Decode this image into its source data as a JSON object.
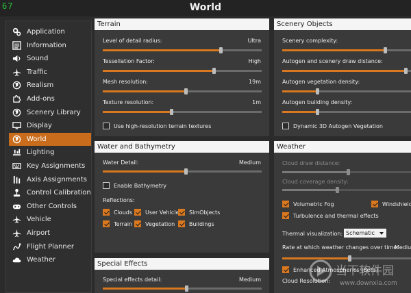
{
  "fps": "67",
  "window_title": "World",
  "sidebar": {
    "items": [
      {
        "label": "Application",
        "icon": "gears-icon"
      },
      {
        "label": "Information",
        "icon": "list-icon"
      },
      {
        "label": "Sound",
        "icon": "speaker-icon"
      },
      {
        "label": "Traffic",
        "icon": "plane-icon"
      },
      {
        "label": "Realism",
        "icon": "globe-icon"
      },
      {
        "label": "Add-ons",
        "icon": "puzzle-icon"
      },
      {
        "label": "Scenery Library",
        "icon": "globe-icon"
      },
      {
        "label": "Display",
        "icon": "monitor-icon"
      },
      {
        "label": "World",
        "icon": "globe-icon",
        "active": true
      },
      {
        "label": "Lighting",
        "icon": "lighting-icon"
      },
      {
        "label": "Key Assignments",
        "icon": "keyboard-icon"
      },
      {
        "label": "Axis Assignments",
        "icon": "axis-icon"
      },
      {
        "label": "Control Calibration",
        "icon": "joystick-icon"
      },
      {
        "label": "Other Controls",
        "icon": "gamepad-icon"
      },
      {
        "label": "Vehicle",
        "icon": "plane-icon"
      },
      {
        "label": "Airport",
        "icon": "plane-icon"
      },
      {
        "label": "Flight Planner",
        "icon": "route-icon"
      },
      {
        "label": "Weather",
        "icon": "cloud-icon"
      }
    ]
  },
  "terrain": {
    "title": "Terrain",
    "sliders": [
      {
        "label": "Level of detail radius:",
        "value": "Ultra",
        "level": 0.74
      },
      {
        "label": "Tessellation Factor:",
        "value": "High",
        "level": 0.7
      },
      {
        "label": "Mesh resolution:",
        "value": "19m",
        "level": 0.52
      },
      {
        "label": "Texture resolution:",
        "value": "1m",
        "level": 0.43
      }
    ],
    "checkbox": {
      "label": "Use high-resolution terrain textures",
      "checked": false
    }
  },
  "scenery": {
    "title": "Scenery Objects",
    "sliders": [
      {
        "label": "Scenery complexity:",
        "level": 0.8
      },
      {
        "label": "Autogen and scenery draw distance:",
        "level": 0.96
      },
      {
        "label": "Autogen vegetation density:",
        "level": 0.27
      },
      {
        "label": "Autogen building density:",
        "level": 0.27
      }
    ],
    "checkbox": {
      "label": "Dynamic 3D Autogen Vegetation",
      "checked": false
    }
  },
  "water": {
    "title": "Water and Bathymetry",
    "slider": {
      "label": "Water Detail:",
      "value": "Medium",
      "level": 0.52
    },
    "enable": {
      "label": "Enable Bathymetry",
      "checked": false
    },
    "reflections_label": "Reflections:",
    "reflections": [
      {
        "label": "Clouds",
        "checked": true
      },
      {
        "label": "User Vehicle",
        "checked": true
      },
      {
        "label": "SimObjects",
        "checked": true
      },
      {
        "label": "Terrain",
        "checked": true
      },
      {
        "label": "Vegetation",
        "checked": true
      },
      {
        "label": "Buildings",
        "checked": true
      }
    ]
  },
  "weather": {
    "title": "Weather",
    "cloud_draw_distance": "Cloud draw distance:",
    "cloud_coverage": "Cloud coverage density:",
    "volumetric_fog": "Volumetric Fog",
    "windshield": "Windshield I",
    "turbulence": "Turbulence and thermal effects",
    "thermal_vis_label": "Thermal visualization:",
    "thermal_vis_value": "Schematic",
    "rate_label": "Rate at which weather changes over time:",
    "rate_value": "Mediu",
    "enhanced": "Enhanced Atmospherics (Beta)",
    "cloud_resolution": "Cloud Resolution:"
  },
  "special": {
    "title": "Special Effects",
    "slider_label": "Special effects detail:",
    "slider_value": "Medium"
  },
  "watermark": {
    "brand": "当下软件园",
    "url": "www.downxia.com"
  }
}
